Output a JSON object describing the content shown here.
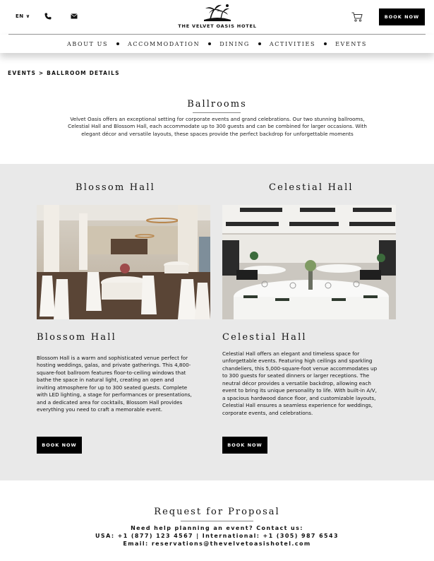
{
  "header": {
    "language": "EN",
    "logo_text": "THE VELVET OASIS HOTEL",
    "book_now": "BOOK NOW"
  },
  "nav": {
    "items": [
      "ABOUT US",
      "ACCOMMODATION",
      "DINING",
      "ACTIVITIES",
      "EVENTS"
    ]
  },
  "breadcrumb": {
    "parent": "EVENTS",
    "separator": ">",
    "current": "BALLROOM DETAILS"
  },
  "intro": {
    "title": "Ballrooms",
    "text": "Velvet Oasis offers an exceptional setting for corporate events and grand celebrations. Our two stunning ballrooms, Celestial Hall and Blossom Hall, each accommodate up to 300 guests and can be combined for larger occasions. With elegant décor and versatile layouts, these spaces provide the perfect backdrop for unforgettable moments"
  },
  "halls": [
    {
      "heading": "Blossom Hall",
      "subheading": "Blossom Hall",
      "description": "Blossom Hall is a warm and sophisticated venue perfect for hosting weddings, galas, and private gatherings. This 4,800-square-foot ballroom features floor-to-ceiling windows that bathe the space in natural light, creating an open and inviting atmosphere for up to 300 seated guests. Complete with LED lighting, a stage for performances or presentations, and a dedicated area for cocktails, Blossom Hall provides everything you need to craft a memorable event.",
      "button": "BOOK NOW"
    },
    {
      "heading": "Celestial Hall",
      "subheading": "Celestial Hall",
      "description": "Celestial Hall offers an elegant and timeless space for unforgettable events. Featuring high ceilings and sparkling chandeliers, this 5,000-square-foot venue accommodates up to 300 guests for seated dinners or larger receptions. The neutral décor provides a versatile backdrop, allowing each event to bring its unique personality to life. With built-in A/V, a spacious hardwood dance floor, and customizable layouts, Celestial Hall ensures a seamless experience for weddings, corporate events, and celebrations.",
      "button": "BOOK NOW"
    }
  ],
  "proposal": {
    "title": "Request for Proposal",
    "line1": "Need help planning an event? Contact us:",
    "line2": "USA: +1 (877) 123 4567 | International: +1 (305) 987 6543",
    "line3": "Email: reservations@thevelvetoasishotel.com"
  },
  "icons": {
    "phone": "phone-icon",
    "mail": "mail-icon",
    "cart": "cart-icon",
    "logo": "palm-tree-logo"
  }
}
